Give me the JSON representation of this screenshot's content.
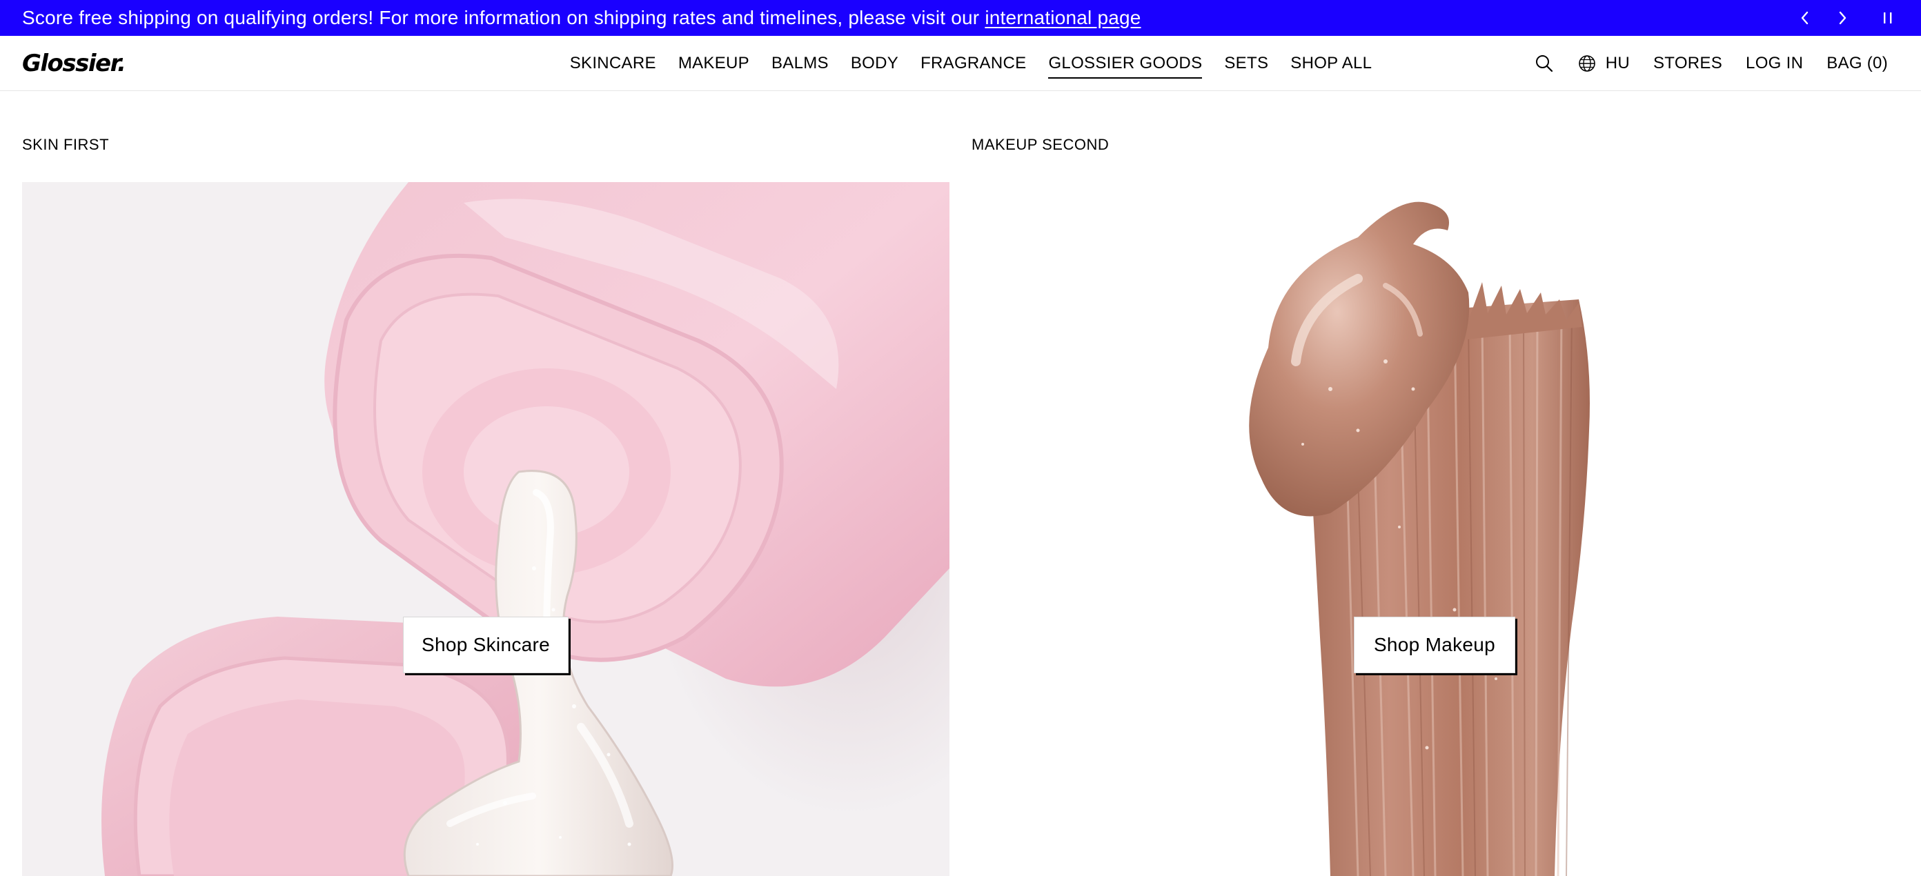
{
  "announcement": {
    "text": "Score free shipping on qualifying orders! For more information on shipping rates and timelines, please visit our ",
    "link_text": "international page",
    "prev_icon": "chevron-left-icon",
    "next_icon": "chevron-right-icon",
    "pause_icon": "pause-icon",
    "background": "#1a00ff"
  },
  "header": {
    "logo": "Glossier.",
    "nav": [
      {
        "label": "SKINCARE"
      },
      {
        "label": "MAKEUP"
      },
      {
        "label": "BALMS"
      },
      {
        "label": "BODY"
      },
      {
        "label": "FRAGRANCE"
      },
      {
        "label": "GLOSSIER GOODS"
      },
      {
        "label": "SETS"
      },
      {
        "label": "SHOP ALL"
      }
    ],
    "active_nav": "GLOSSIER GOODS",
    "search_icon": "search-icon",
    "region_icon": "globe-icon",
    "region_label": "HU",
    "stores_label": "STORES",
    "login_label": "LOG IN",
    "bag_label": "BAG (0)"
  },
  "sections": {
    "left": {
      "label": "SKIN FIRST",
      "cta": "Shop Skincare",
      "image": "pink-jelly-cleanser-image"
    },
    "right": {
      "label": "MAKEUP SECOND",
      "cta": "Shop Makeup",
      "image": "bronze-shimmer-swatch-image"
    }
  }
}
